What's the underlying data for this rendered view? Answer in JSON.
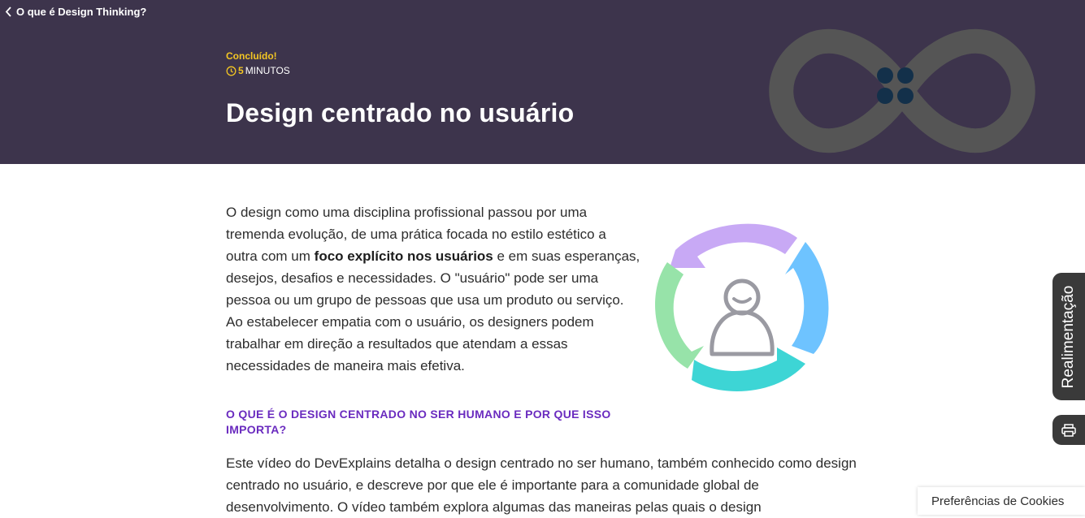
{
  "nav": {
    "back_label": "O que é Design Thinking?"
  },
  "hero": {
    "status": "Concluído!",
    "duration_number": "5",
    "duration_unit": "MINUTOS",
    "title": "Design centrado no usuário"
  },
  "content": {
    "para1_a": "O design como uma disciplina profissional passou por uma tremenda evolução, de uma prática focada no estilo estético a outra com um ",
    "para1_bold": "foco explícito nos usuários",
    "para1_b": " e em suas esperanças, desejos, desafios e necessidades. O \"usuário\" pode ser uma pessoa ou um grupo de pessoas que usa um produto ou serviço. Ao estabelecer empatia com o usuário, os designers podem trabalhar em direção a resultados que atendam a essas necessidades de maneira mais efetiva.",
    "section_heading": "O QUE É O DESIGN CENTRADO NO SER HUMANO E POR QUE ISSO IMPORTA?",
    "para2": "Este vídeo do DevExplains detalha o design centrado no ser humano, também conhecido como design centrado no usuário, e descreve por que ele é importante para a comunidade global de desenvolvimento. O vídeo também explora algumas das maneiras pelas quais o design"
  },
  "side": {
    "feedback_label": "Realimentação",
    "cookie_label": "Preferências de Cookies"
  },
  "icons": [
    "chevron-left-icon",
    "clock-icon",
    "infinity-logo-icon",
    "user-cycle-illustration",
    "printer-icon"
  ],
  "colors": {
    "header_bg": "#3d344c",
    "accent_yellow": "#f3c623",
    "heading_purple": "#6a2bbf",
    "cycle_purple": "#c8a9f5",
    "cycle_blue": "#6ec3ff",
    "cycle_teal": "#3dd5d5",
    "cycle_green": "#97e3a9"
  }
}
